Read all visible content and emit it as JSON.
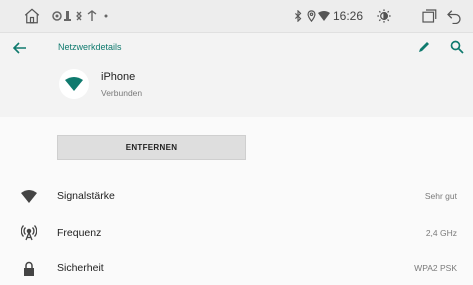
{
  "colors": {
    "accent": "#0f7a6e",
    "icon_dark": "#444444"
  },
  "status_bar": {
    "time": "16:26",
    "icons": [
      "home-icon",
      "notification-icons",
      "bluetooth-icon",
      "location-icon",
      "wifi-icon",
      "brightness-icon",
      "window-icon",
      "back-icon"
    ]
  },
  "header": {
    "title": "Netzwerkdetails",
    "back_icon": "arrow-left-icon",
    "edit_icon": "pencil-icon",
    "search_icon": "search-icon"
  },
  "network": {
    "name": "iPhone",
    "status": "Verbunden"
  },
  "forget_button": "ENTFERNEN",
  "details": [
    {
      "label": "Signalstärke",
      "value": "Sehr gut",
      "icon": "wifi-signal-icon"
    },
    {
      "label": "Frequenz",
      "value": "2,4 GHz",
      "icon": "antenna-icon"
    },
    {
      "label": "Sicherheit",
      "value": "WPA2 PSK",
      "icon": "lock-icon"
    }
  ]
}
